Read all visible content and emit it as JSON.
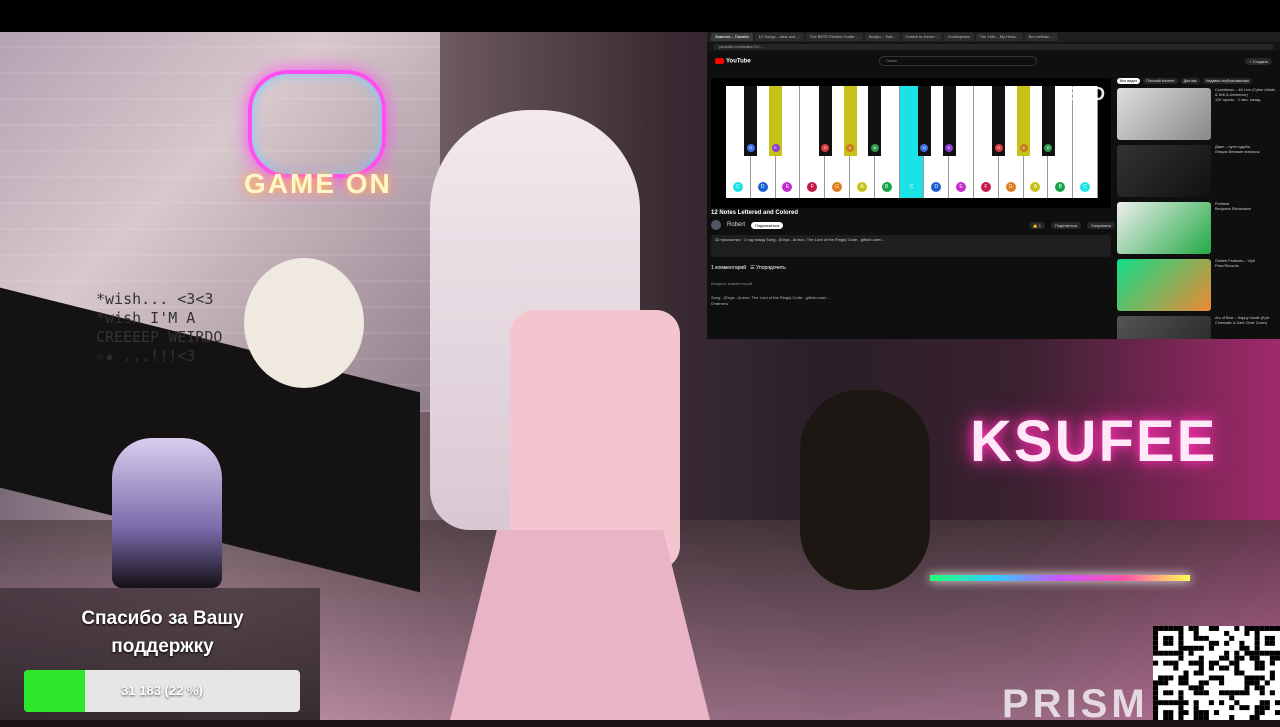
{
  "stream": {
    "neon_sign_left": "GAME ON",
    "neon_sign_right": "KSUFEE",
    "shirt_text": "*wish... <3<3 *wish I'M A CREEEEP WEIRDO ☆★ ...!!!<3",
    "watermark": "PRISM"
  },
  "browser": {
    "tabs": [
      "Заметки – Папайя",
      "10 Songs – tabs and ...",
      "The BEST Electric Guitar ...",
      "Ксуфи – Twit...",
      "Cosine in chrom...",
      "Сообщения",
      "The 10th – My Heav...",
      "Вот сейчас ..."
    ],
    "url": "youtube.com/watch?v=...",
    "youtube": {
      "logo": "YouTube",
      "search_placeholder": "Поиск",
      "create_button": "+ Создать",
      "watermark": "VEED",
      "video_title": "12 Notes Lettered and Colored",
      "channel_name": "Robert",
      "subscribe_button": "Подписаться",
      "like_count": "1",
      "share_button": "Поделиться",
      "save_button": "Сохранить",
      "description": "32 просмотра · 1 год назад  Song - (Enya - Aníron, The Lord of the Rings)  Code - github.com/...",
      "comments_header": "1 комментарий",
      "sort_button": "Упорядочить",
      "add_comment": "Введите комментарий",
      "comment_text": "Song - (Enya - Aníron, The Lord of the Rings) Code - github.com/...",
      "reply_button": "Ответить",
      "chips": [
        "Все видео",
        "Похожий контент",
        "Для вас",
        "Недавно опубликованные"
      ],
      "recommendations": [
        {
          "title": "Countdown – 4K Live (Cyber Artists & Drill & Ambience)",
          "meta": "12K просм. · 1 мес. назад"
        },
        {
          "title": "Джин – пути судьбы",
          "meta": "Лекция Великие вопросы"
        },
        {
          "title": "Portland",
          "meta": "Benjamin Richardson"
        },
        {
          "title": "Golden Features – Vlyd",
          "meta": "Fesa Records"
        },
        {
          "title": "Arc of Bow – Happy hustle (Epic Cinematic & Dark Choir Cover)",
          "meta": ""
        }
      ]
    },
    "piano": {
      "white_keys": [
        {
          "note": "C",
          "color": "#19e3e6"
        },
        {
          "note": "D",
          "color": "#1a5fd6"
        },
        {
          "note": "E",
          "color": "#c42ccf"
        },
        {
          "note": "F",
          "color": "#c41a4b"
        },
        {
          "note": "G",
          "color": "#e07c1a"
        },
        {
          "note": "A",
          "color": "#c7c21a"
        },
        {
          "note": "B",
          "color": "#17a34a"
        },
        {
          "note": "C",
          "color": "#19e3e6"
        },
        {
          "note": "D",
          "color": "#1a5fd6"
        },
        {
          "note": "E",
          "color": "#c42ccf"
        },
        {
          "note": "F",
          "color": "#c41a4b"
        },
        {
          "note": "G",
          "color": "#e07c1a"
        },
        {
          "note": "A",
          "color": "#c7c21a"
        },
        {
          "note": "B",
          "color": "#17a34a"
        },
        {
          "note": "C",
          "color": "#19e3e6"
        }
      ],
      "black_keys": [
        {
          "note": "D",
          "color": "#3f6ee6"
        },
        {
          "note": "E",
          "color": "#8b3bd6"
        },
        {
          "note": "G",
          "color": "#d83a3a"
        },
        {
          "note": "A",
          "color": "#c97a1a"
        },
        {
          "note": "B",
          "color": "#2a9e4a"
        },
        {
          "note": "D",
          "color": "#3f6ee6"
        },
        {
          "note": "E",
          "color": "#8b3bd6"
        },
        {
          "note": "G",
          "color": "#d83a3a"
        },
        {
          "note": "A",
          "color": "#c97a1a"
        },
        {
          "note": "B",
          "color": "#2a9e4a"
        }
      ],
      "highlighted_white_key": 7,
      "highlighted_black_keys": [
        1,
        3,
        8
      ]
    }
  },
  "donation": {
    "thanks_text": "Спасибо за Вашу поддержку",
    "progress_label": "31 183 (22 %)",
    "progress_fraction": 0.22,
    "accent_color": "#2ee82e"
  }
}
